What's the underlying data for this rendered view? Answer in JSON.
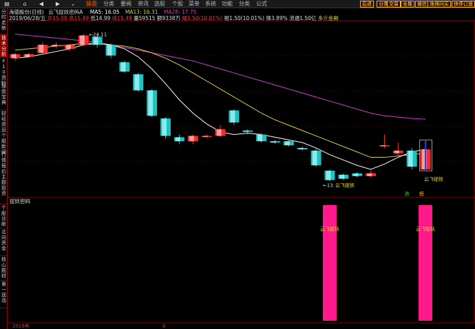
{
  "toolbar": {
    "home_icon": "home-icon",
    "menu": [
      "操盘",
      "分类",
      "要闻",
      "资讯",
      "选股",
      "个股",
      "菜单",
      "系统",
      "功能",
      "分类",
      "公式"
    ],
    "buttons": [
      "后退",
      "分类",
      "交易",
      "全推",
      "微信",
      "逸得问买",
      "快停订盘"
    ]
  },
  "sidebar": {
    "tabs": [
      "分时走势",
      "技术分析",
      "F10资料",
      "操盘宝典",
      "财经资讯",
      "个股新闻",
      "行情报价",
      "主题投资",
      "个股诊断",
      "北向资金",
      "核心题材",
      "第一现场"
    ]
  },
  "header": {
    "title": "海德股份(日线)",
    "indicator": "云飞捉妖密码A",
    "ma5": "MA5: 16.05",
    "ma13": "MA13: 16.31",
    "ma28": "MA28: 17.75",
    "date": "2019/06/28/五",
    "open": "开15.00",
    "high": "高15.49",
    "low": "低14.99",
    "close": "收15.49",
    "volume": "量59515",
    "amount": "额9338万",
    "change_pct": "幅1.50(10.01%)",
    "change": "振1.50(10.01%)",
    "turnover": "换3.89%",
    "float": "流通1.50亿",
    "concept": "多元金融"
  },
  "chart_annotations": {
    "high_label": "24.11",
    "low_label": "13.",
    "signal_label": "云飞捉妖",
    "mark1": "跌",
    "mark2": "榜"
  },
  "sub_panel": {
    "title": "捉妖密码",
    "bar_label": "云飞捉妖"
  },
  "bottom": {
    "year": "2019年",
    "month": "6"
  },
  "colors": {
    "up": "#ff2a2a",
    "down": "#16c6c6",
    "ma5": "#ffffff",
    "ma13": "#d8d23a",
    "ma28": "#d23ad2",
    "signal_bar": "#ff1a8c",
    "accent": "#ff5a00"
  },
  "chart_data": {
    "type": "candlestick",
    "ylim": [
      12,
      25
    ],
    "candles": [
      {
        "o": 22.3,
        "h": 22.7,
        "l": 22.1,
        "c": 22.6
      },
      {
        "o": 22.4,
        "h": 22.7,
        "l": 22.3,
        "c": 22.6
      },
      {
        "o": 22.7,
        "h": 23.5,
        "l": 22.6,
        "c": 23.3
      },
      {
        "o": 23.2,
        "h": 23.5,
        "l": 23.0,
        "c": 23.3
      },
      {
        "o": 23.0,
        "h": 23.3,
        "l": 22.8,
        "c": 23.3
      },
      {
        "o": 23.3,
        "h": 24.11,
        "l": 23.2,
        "c": 24.0
      },
      {
        "o": 23.9,
        "h": 24.0,
        "l": 23.1,
        "c": 23.3
      },
      {
        "o": 23.3,
        "h": 23.4,
        "l": 22.3,
        "c": 22.5
      },
      {
        "o": 22.0,
        "h": 22.1,
        "l": 21.2,
        "c": 21.3
      },
      {
        "o": 21.1,
        "h": 21.2,
        "l": 19.8,
        "c": 19.9
      },
      {
        "o": 19.9,
        "h": 20.0,
        "l": 17.9,
        "c": 18.0
      },
      {
        "o": 17.8,
        "h": 17.9,
        "l": 16.3,
        "c": 16.5
      },
      {
        "o": 16.4,
        "h": 16.6,
        "l": 15.9,
        "c": 16.1
      },
      {
        "o": 16.1,
        "h": 16.6,
        "l": 15.9,
        "c": 16.5
      },
      {
        "o": 16.5,
        "h": 16.6,
        "l": 16.3,
        "c": 16.5
      },
      {
        "o": 16.5,
        "h": 17.3,
        "l": 16.4,
        "c": 17.0
      },
      {
        "o": 18.4,
        "h": 18.5,
        "l": 17.3,
        "c": 17.5
      },
      {
        "o": 16.9,
        "h": 17.0,
        "l": 16.6,
        "c": 16.8
      },
      {
        "o": 16.6,
        "h": 16.7,
        "l": 16.0,
        "c": 16.1
      },
      {
        "o": 16.1,
        "h": 16.2,
        "l": 15.9,
        "c": 16.0
      },
      {
        "o": 16.1,
        "h": 16.2,
        "l": 15.7,
        "c": 15.8
      },
      {
        "o": 15.6,
        "h": 15.7,
        "l": 15.4,
        "c": 15.5
      },
      {
        "o": 15.4,
        "h": 15.6,
        "l": 14.2,
        "c": 14.3
      },
      {
        "o": 13.9,
        "h": 14.0,
        "l": 13.1,
        "c": 13.2
      },
      {
        "o": 13.6,
        "h": 13.7,
        "l": 13.2,
        "c": 13.3
      },
      {
        "o": 13.7,
        "h": 13.8,
        "l": 13.4,
        "c": 13.5
      },
      {
        "o": 13.5,
        "h": 13.9,
        "l": 13.4,
        "c": 13.7
      },
      {
        "o": 15.8,
        "h": 16.6,
        "l": 15.6,
        "c": 15.8
      },
      {
        "o": 15.2,
        "h": 16.0,
        "l": 15.0,
        "c": 15.4
      },
      {
        "o": 15.4,
        "h": 15.6,
        "l": 14.0,
        "c": 14.2
      },
      {
        "o": 14.0,
        "h": 15.5,
        "l": 14.0,
        "c": 15.5
      }
    ],
    "ma5": [
      22.3,
      22.4,
      22.6,
      22.8,
      23.0,
      23.3,
      23.4,
      23.3,
      23.0,
      22.4,
      21.5,
      20.4,
      19.2,
      18.2,
      17.4,
      16.8,
      16.6,
      16.7,
      16.6,
      16.4,
      16.2,
      16.0,
      15.6,
      15.1,
      14.7,
      14.3,
      14.0,
      14.4,
      14.9,
      15.3,
      15.5
    ],
    "ma13": [
      22.9,
      23.0,
      23.1,
      23.2,
      23.3,
      23.4,
      23.4,
      23.3,
      23.2,
      23.0,
      22.7,
      22.3,
      21.8,
      21.2,
      20.6,
      20.0,
      19.4,
      18.8,
      18.2,
      17.7,
      17.3,
      16.9,
      16.5,
      16.1,
      15.7,
      15.3,
      14.9,
      14.9,
      15.0,
      15.1,
      15.2
    ],
    "ma28": [
      24.1,
      24.0,
      23.9,
      23.8,
      23.7,
      23.6,
      23.5,
      23.3,
      23.1,
      22.9,
      22.7,
      22.5,
      22.3,
      22.1,
      21.8,
      21.5,
      21.2,
      20.9,
      20.6,
      20.3,
      20.0,
      19.7,
      19.4,
      19.1,
      18.8,
      18.5,
      18.2,
      18.0,
      17.9,
      17.8,
      17.75
    ],
    "signals": [
      23,
      30
    ]
  }
}
